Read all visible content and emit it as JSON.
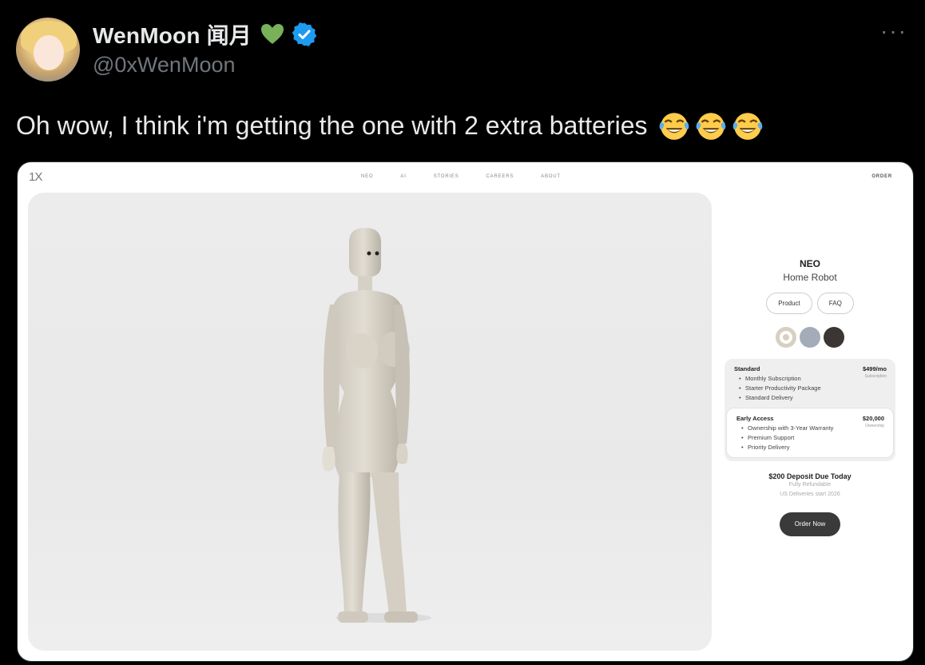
{
  "tweet": {
    "display_name": "WenMoon 闻月",
    "handle": "@0xWenMoon",
    "text": "Oh wow, I think i'm getting the one with 2 extra batteries",
    "emojis": [
      "face-with-tears-of-joy",
      "face-with-tears-of-joy",
      "face-with-tears-of-joy"
    ],
    "more_label": "···"
  },
  "site": {
    "logo": "1X",
    "nav": [
      "NEO",
      "AI",
      "STORIES",
      "CAREERS",
      "ABOUT"
    ],
    "order_link": "ORDER",
    "product": {
      "title": "NEO",
      "subtitle": "Home Robot",
      "tabs": [
        "Product",
        "FAQ"
      ],
      "colors": [
        "#d9cfc1",
        "#a3acb8",
        "#3b3633"
      ],
      "plans": [
        {
          "name": "Standard",
          "price": "$499/mo",
          "price_note": "Subscription",
          "features": [
            "Monthly Subscription",
            "Starter Productivity Package",
            "Standard Delivery"
          ]
        },
        {
          "name": "Early Access",
          "price": "$20,000",
          "price_note": "Ownership",
          "features": [
            "Ownership with 3-Year Warranty",
            "Premium Support",
            "Priority Delivery"
          ]
        }
      ],
      "deposit": "$200 Deposit Due Today",
      "fine_print": [
        "Fully Refundable",
        "US Deliveries start 2026"
      ],
      "cta": "Order Now"
    }
  }
}
